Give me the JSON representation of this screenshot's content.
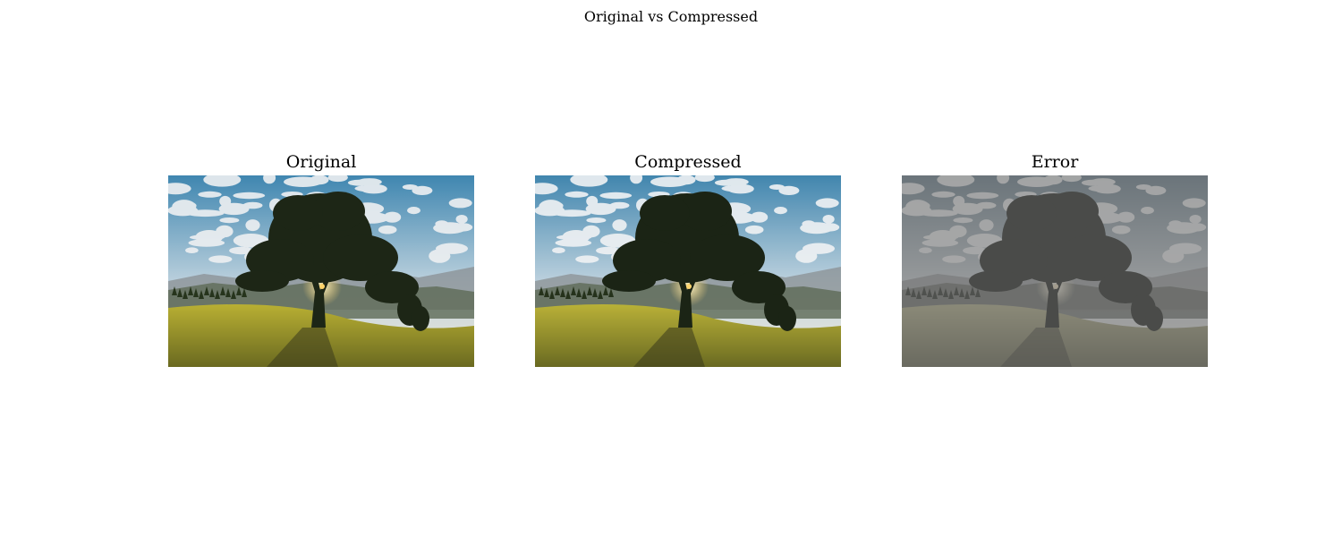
{
  "figure": {
    "title": "Original vs Compressed"
  },
  "panels": [
    {
      "title": "Original",
      "variant": "original"
    },
    {
      "title": "Compressed",
      "variant": "compressed"
    },
    {
      "title": "Error",
      "variant": "error"
    }
  ],
  "scene": {
    "subject": "lone tree on grassy hillside under cloudy blue sky with sun behind trunk",
    "colors": {
      "sky_blue": "#3f86b0",
      "cloud": "#eef0f2",
      "haze": "#f3ead8",
      "mountain": "#8a8f93",
      "tree": "#1d2616",
      "grass_light": "#b9b033",
      "grass_dark": "#6a6a20",
      "shadow": "#3a3a1c",
      "sun": "#ffd36a"
    }
  }
}
